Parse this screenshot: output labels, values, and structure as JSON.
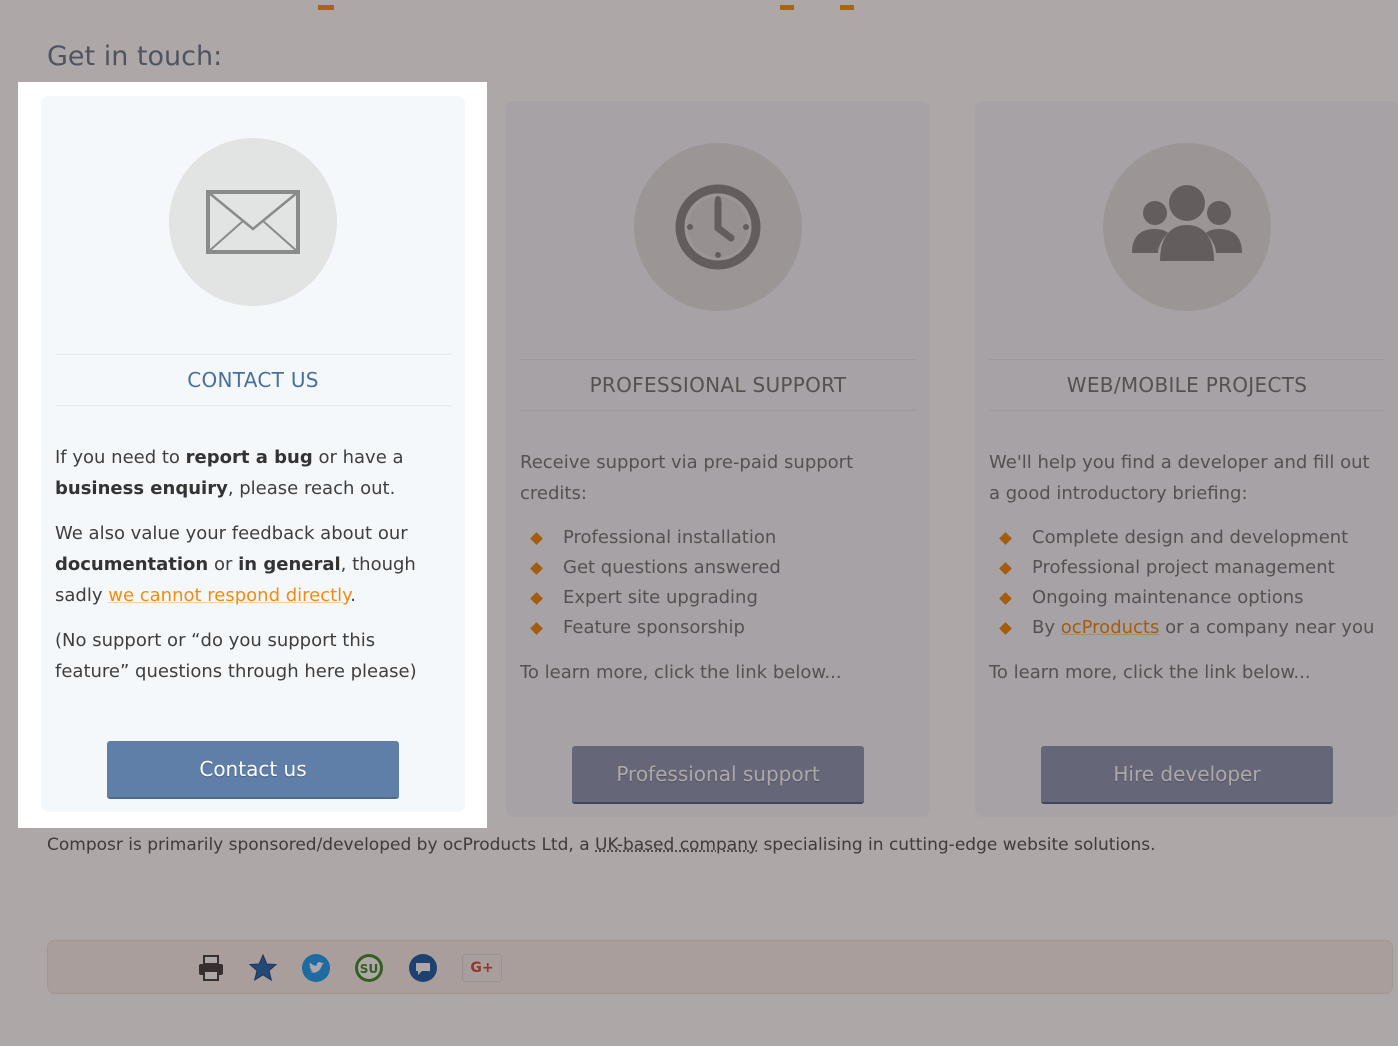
{
  "page": {
    "title": "Get in touch:",
    "accent_color": "#f39c12",
    "link_color": "#f08c10",
    "button_color": "#5f7ea8",
    "heading_color": "#48709b"
  },
  "cards": {
    "contact": {
      "icon": "envelope-icon",
      "heading": "CONTACT US",
      "p1_a": "If you need to ",
      "p1_b": "report a bug",
      "p1_c": " or have a ",
      "p1_d": "business enquiry",
      "p1_e": ", please reach out.",
      "p2_a": "We also value your feedback about our ",
      "p2_b": "documentation",
      "p2_c": " or ",
      "p2_d": "in general",
      "p2_e": ", though sadly ",
      "p2_link": "we cannot respond directly",
      "p2_f": ".",
      "p3": "(No support or “do you support this feature” questions through here please)",
      "button": "Contact us"
    },
    "support": {
      "icon": "clock-icon",
      "heading": "PROFESSIONAL SUPPORT",
      "intro": "Receive support via pre-paid support credits:",
      "bullets": [
        "Professional installation",
        "Get questions answered",
        "Expert site upgrading",
        "Feature sponsorship"
      ],
      "more": "To learn more, click the link below...",
      "button": "Professional support"
    },
    "projects": {
      "icon": "group-icon",
      "heading": "WEB/MOBILE PROJECTS",
      "intro": "We'll help you find a developer and fill out a good introductory briefing:",
      "bullets": [
        "Complete design and development",
        "Professional project management",
        "Ongoing maintenance options"
      ],
      "b4_a": "By ",
      "b4_link": "ocProducts",
      "b4_b": " or a company near you",
      "more": "To learn more, click the link below...",
      "button": "Hire developer"
    }
  },
  "footer": {
    "t1": "Composr is primarily sponsored/developed by ocProducts Ltd, a ",
    "t2": "UK-based company",
    "t3": " specialising in cutting-edge website solutions."
  },
  "share": {
    "icons": [
      "print-icon",
      "favorite-star-icon",
      "twitter-icon",
      "stumbleupon-icon",
      "delicious-icon",
      "google-plus-icon"
    ],
    "gplus_label": "G+"
  }
}
